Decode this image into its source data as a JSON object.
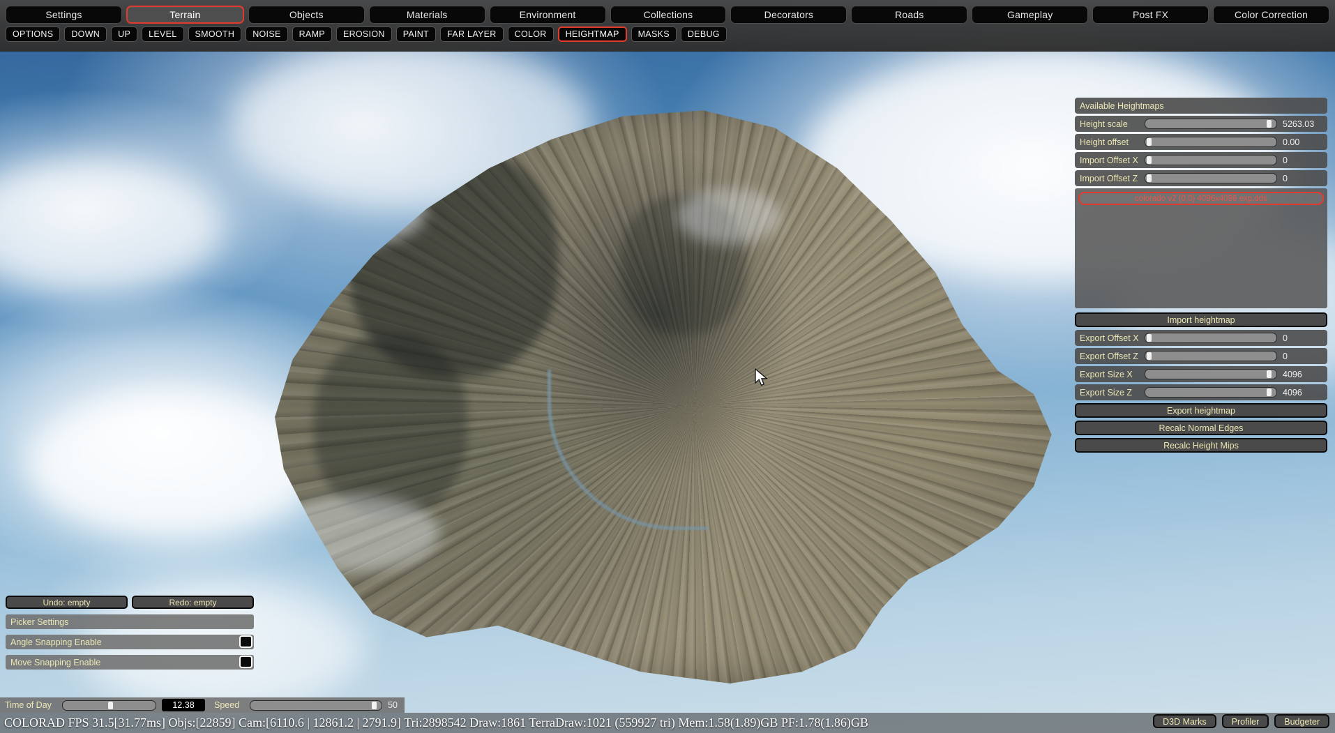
{
  "top_tabs": [
    {
      "label": "Settings",
      "active": false
    },
    {
      "label": "Terrain",
      "active": true
    },
    {
      "label": "Objects",
      "active": false
    },
    {
      "label": "Materials",
      "active": false
    },
    {
      "label": "Environment",
      "active": false
    },
    {
      "label": "Collections",
      "active": false
    },
    {
      "label": "Decorators",
      "active": false
    },
    {
      "label": "Roads",
      "active": false
    },
    {
      "label": "Gameplay",
      "active": false
    },
    {
      "label": "Post FX",
      "active": false
    },
    {
      "label": "Color Correction",
      "active": false
    }
  ],
  "tool_tabs": [
    {
      "label": "OPTIONS",
      "active": false
    },
    {
      "label": "DOWN",
      "active": false
    },
    {
      "label": "UP",
      "active": false
    },
    {
      "label": "LEVEL",
      "active": false
    },
    {
      "label": "SMOOTH",
      "active": false
    },
    {
      "label": "NOISE",
      "active": false
    },
    {
      "label": "RAMP",
      "active": false
    },
    {
      "label": "EROSION",
      "active": false
    },
    {
      "label": "PAINT",
      "active": false
    },
    {
      "label": "FAR LAYER",
      "active": false
    },
    {
      "label": "COLOR",
      "active": false
    },
    {
      "label": "HEIGHTMAP",
      "active": true
    },
    {
      "label": "MASKS",
      "active": false
    },
    {
      "label": "DEBUG",
      "active": false
    }
  ],
  "heightmap_panel": {
    "header": "Available Heightmaps",
    "sliders": [
      {
        "label": "Height scale",
        "value": "5263.03",
        "fill": 96
      },
      {
        "label": "Height offset",
        "value": "0.00",
        "fill": 1
      },
      {
        "label": "Import Offset X",
        "value": "0",
        "fill": 1
      },
      {
        "label": "Import Offset Z",
        "value": "0",
        "fill": 1
      }
    ],
    "list_items": [
      {
        "label": "colorado  v2  (0,0)  4096x4096  exp.dds",
        "selected": true
      }
    ],
    "import_button": "Import heightmap",
    "export_sliders": [
      {
        "label": "Export Offset X",
        "value": "0",
        "fill": 1
      },
      {
        "label": "Export Offset Z",
        "value": "0",
        "fill": 1
      },
      {
        "label": "Export Size X",
        "value": "4096",
        "fill": 96
      },
      {
        "label": "Export Size Z",
        "value": "4096",
        "fill": 96
      }
    ],
    "buttons": [
      {
        "label": "Export heightmap"
      },
      {
        "label": "Recalc Normal Edges"
      },
      {
        "label": "Recalc Height Mips"
      }
    ]
  },
  "left_panel": {
    "undo": "Undo: empty",
    "redo": "Redo: empty",
    "picker_settings": "Picker Settings",
    "toggles": [
      {
        "label": "Angle Snapping Enable",
        "checked": false
      },
      {
        "label": "Move Snapping Enable",
        "checked": false
      }
    ]
  },
  "bottom": {
    "time_of_day_label": "Time of Day",
    "time_of_day_value": "12.38",
    "time_of_day_fill": 52,
    "speed_label": "Speed",
    "speed_value": "50",
    "speed_fill": 96,
    "status": "COLORAD FPS 31.5[31.77ms] Objs:[22859] Cam:[6110.6 | 12861.2 | 2791.9] Tri:2898542 Draw:1861 TerraDraw:1021 (559927 tri) Mem:1.58(1.89)GB PF:1.78(1.86)GB",
    "perf_buttons": [
      {
        "label": "D3D Marks"
      },
      {
        "label": "Profiler"
      },
      {
        "label": "Budgeter"
      }
    ]
  },
  "colors": {
    "accent_red": "#e23b2e",
    "label_cream": "#ece7b4",
    "panel_gray": "#4e4e4e",
    "tab_black": "#080808"
  }
}
